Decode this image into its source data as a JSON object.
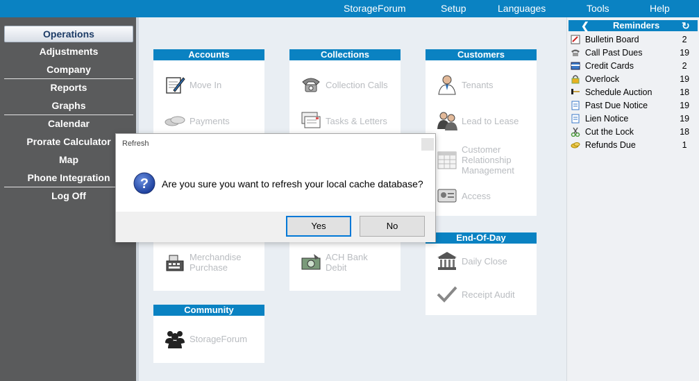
{
  "topbar": {
    "menus": [
      "StorageForum",
      "Setup",
      "Languages",
      "Tools",
      "Help"
    ]
  },
  "sidebar": {
    "items": [
      "Operations",
      "Adjustments",
      "Company",
      "Reports",
      "Graphs",
      "Calendar",
      "Prorate Calculator",
      "Map",
      "Phone Integration",
      "Log Off"
    ],
    "active": "Operations"
  },
  "panels": {
    "accounts": {
      "title": "Accounts",
      "items": [
        "Move In",
        "Payments",
        "Merchandise Purchase"
      ]
    },
    "collections": {
      "title": "Collections",
      "items": [
        "Collection Calls",
        "Tasks & Letters",
        "ACH Bank Debit"
      ]
    },
    "customers": {
      "title": "Customers",
      "items": [
        "Tenants",
        "Lead to Lease",
        "Customer Relationship Management",
        "Access"
      ]
    },
    "endofday": {
      "title": "End-Of-Day",
      "items": [
        "Daily Close",
        "Receipt Audit"
      ]
    },
    "community": {
      "title": "Community",
      "items": [
        "StorageForum"
      ]
    }
  },
  "reminders": {
    "title": "Reminders",
    "rows": [
      {
        "label": "Bulletin Board",
        "count": "2"
      },
      {
        "label": "Call Past Dues",
        "count": "19"
      },
      {
        "label": "Credit Cards",
        "count": "2"
      },
      {
        "label": "Overlock",
        "count": "19"
      },
      {
        "label": "Schedule Auction",
        "count": "18"
      },
      {
        "label": "Past Due Notice",
        "count": "19"
      },
      {
        "label": "Lien Notice",
        "count": "19"
      },
      {
        "label": "Cut the Lock",
        "count": "18"
      },
      {
        "label": "Refunds Due",
        "count": "1"
      }
    ]
  },
  "dialog": {
    "title": "Refresh",
    "message": "Are you sure you want to refresh your local cache database?",
    "yes": "Yes",
    "no": "No"
  },
  "colors": {
    "accent": "#0a82c2",
    "sidebar": "#5a5b5c",
    "content_bg": "#e9eef3"
  }
}
